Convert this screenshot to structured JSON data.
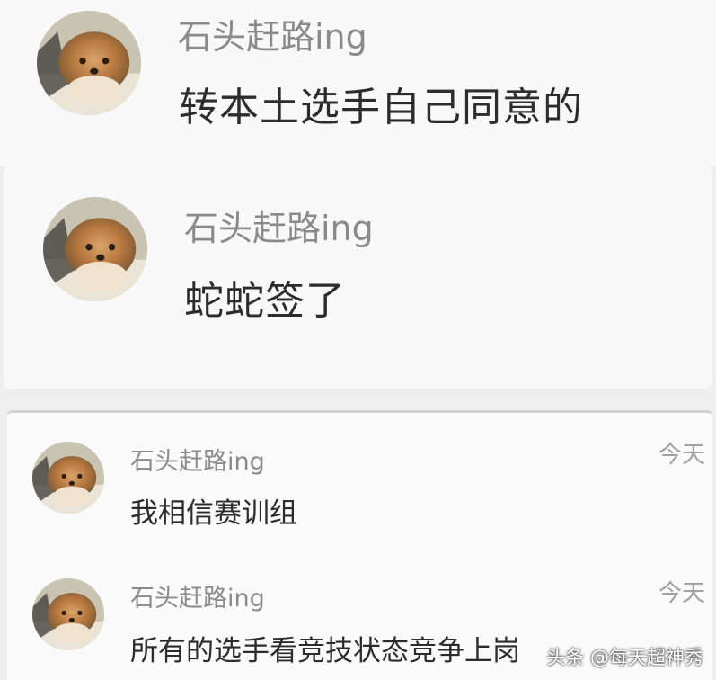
{
  "comments_top": [
    {
      "username": "石头赶路ing",
      "text": "转本土选手自己同意的"
    },
    {
      "username": "石头赶路ing",
      "text": "蛇蛇签了"
    }
  ],
  "comments_bottom": [
    {
      "username": "石头赶路ing",
      "text": "我相信赛训组",
      "time": "今天"
    },
    {
      "username": "石头赶路ing",
      "text": "所有的选手看竞技状态竞争上岗",
      "time": "今天"
    }
  ],
  "watermark": "头条 @每天超神秀",
  "colors": {
    "username": "#8a8a8a",
    "message": "#2c2c2c",
    "background": "#eeeeee"
  },
  "icons": [
    "dog-avatar-icon"
  ]
}
